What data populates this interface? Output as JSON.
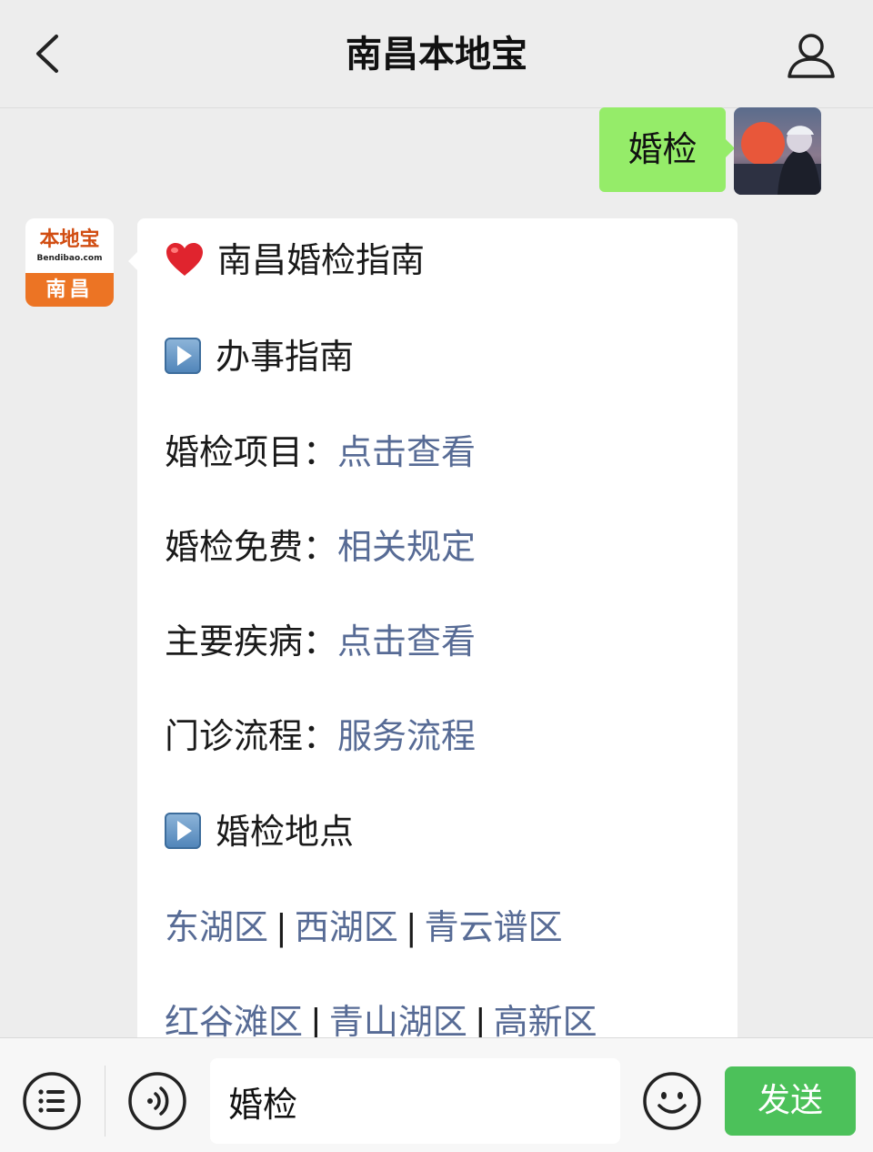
{
  "header": {
    "title": "南昌本地宝"
  },
  "outgoing": {
    "text": "婚检"
  },
  "bot": {
    "logo": {
      "brand_cn": "本地宝",
      "brand_en": "Bendibao.com",
      "city": "南昌"
    },
    "heading": "南昌婚检指南",
    "section1": "办事指南",
    "items": [
      {
        "label": "婚检项目：",
        "link": "点击查看"
      },
      {
        "label": "婚检免费：",
        "link": "相关规定"
      },
      {
        "label": "主要疾病：",
        "link": "点击查看"
      },
      {
        "label": "门诊流程：",
        "link": "服务流程"
      }
    ],
    "section2": "婚检地点",
    "districts_row1": [
      "东湖区",
      "西湖区",
      "青云谱区"
    ],
    "districts_row2": [
      "红谷滩区",
      "青山湖区",
      "高新区"
    ],
    "separator": "|"
  },
  "input": {
    "value": "婚检"
  },
  "actions": {
    "send_label": "发送"
  },
  "colors": {
    "my_bubble": "#95ec69",
    "link": "#576b95",
    "send": "#4cc15a",
    "logo_orange": "#ec7424"
  },
  "icons": [
    "back-icon",
    "profile-icon",
    "heart-icon",
    "play-icon",
    "menu-icon",
    "voice-icon",
    "emoji-icon"
  ]
}
